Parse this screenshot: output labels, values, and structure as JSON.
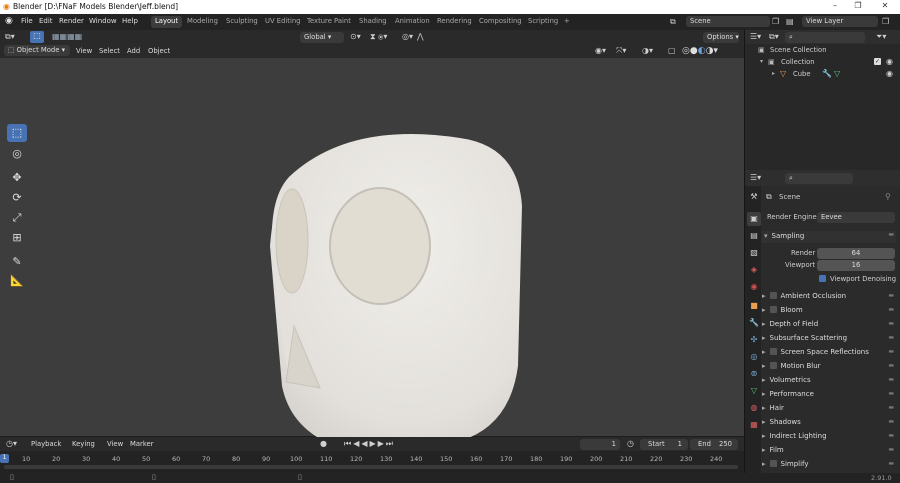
{
  "window": {
    "title": "Blender [D:\\FNaF Models Blender\\Jeff.blend]",
    "min": "–",
    "max": "❐",
    "close": "✕"
  },
  "menu": [
    "File",
    "Edit",
    "Render",
    "Window",
    "Help"
  ],
  "workspaces": [
    "Layout",
    "Modeling",
    "Sculpting",
    "UV Editing",
    "Texture Paint",
    "Shading",
    "Animation",
    "Rendering",
    "Compositing",
    "Scripting"
  ],
  "workspace_add": "+",
  "scene": {
    "name": "Scene",
    "view_layer": "View Layer"
  },
  "viewport_header": {
    "transform": "Global",
    "options": "Options"
  },
  "viewport_header2": {
    "mode": "Object Mode",
    "menus": [
      "View",
      "Select",
      "Add",
      "Object"
    ]
  },
  "outliner": {
    "scene_collection": "Scene Collection",
    "collection": "Collection",
    "object": "Cube"
  },
  "properties": {
    "scene": "Scene",
    "render_engine_label": "Render Engine",
    "render_engine": "Eevee",
    "sampling": "Sampling",
    "render_label": "Render",
    "render_value": "64",
    "viewport_label": "Viewport",
    "viewport_value": "16",
    "denoise": "Viewport Denoising",
    "panels": [
      {
        "label": "Ambient Occlusion",
        "checkbox": true
      },
      {
        "label": "Bloom",
        "checkbox": true
      },
      {
        "label": "Depth of Field",
        "checkbox": false
      },
      {
        "label": "Subsurface Scattering",
        "checkbox": false
      },
      {
        "label": "Screen Space Reflections",
        "checkbox": true
      },
      {
        "label": "Motion Blur",
        "checkbox": true
      },
      {
        "label": "Volumetrics",
        "checkbox": false
      },
      {
        "label": "Performance",
        "checkbox": false
      },
      {
        "label": "Hair",
        "checkbox": false
      },
      {
        "label": "Shadows",
        "checkbox": false
      },
      {
        "label": "Indirect Lighting",
        "checkbox": false
      },
      {
        "label": "Film",
        "checkbox": false
      },
      {
        "label": "Simplify",
        "checkbox": true
      }
    ]
  },
  "timeline": {
    "menus": [
      "Playback",
      "Keying",
      "View",
      "Marker"
    ],
    "current_frame": "1",
    "start_label": "Start",
    "start": "1",
    "end_label": "End",
    "end": "250"
  },
  "ruler_ticks": [
    "10",
    "20",
    "30",
    "40",
    "50",
    "60",
    "70",
    "80",
    "90",
    "100",
    "110",
    "120",
    "130",
    "140",
    "150",
    "160",
    "170",
    "180",
    "190",
    "200",
    "210",
    "220",
    "230",
    "240"
  ],
  "ruler_cursor": "1",
  "status": {
    "version": "2.91.0"
  },
  "colors": {
    "accent": "#4772b3",
    "viewport_bg": "#3d3d3d",
    "model": "#e6e4df"
  }
}
